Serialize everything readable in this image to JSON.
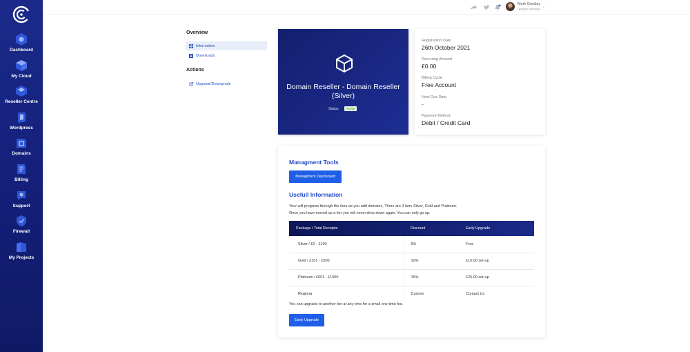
{
  "sidebar": {
    "items": [
      {
        "label": "Dashboard",
        "icon": "dashboard-icon"
      },
      {
        "label": "My Cloud",
        "icon": "cloud-icon"
      },
      {
        "label": "Reseller Centre",
        "icon": "reseller-icon"
      },
      {
        "label": "Wordpress",
        "icon": "wordpress-icon"
      },
      {
        "label": "Domains",
        "icon": "domains-icon"
      },
      {
        "label": "Billing",
        "icon": "billing-icon"
      },
      {
        "label": "Support",
        "icon": "support-icon"
      },
      {
        "label": "Firewall",
        "icon": "firewall-icon"
      },
      {
        "label": "My Projects",
        "icon": "projects-icon"
      }
    ]
  },
  "topbar": {
    "user_name": "Mark Grieday",
    "user_org": "UKBSD GROUP"
  },
  "menu": {
    "overview_title": "Overview",
    "information": "Information",
    "downloads": "Downloads",
    "actions_title": "Actions",
    "upgrade": "Upgrade/Downgrade"
  },
  "product": {
    "title": "Domain Reseller - Domain Reseller (Silver)",
    "status_label": "Status:",
    "status_value": "Active"
  },
  "info": {
    "registration_label": "Registration Date",
    "registration_value": "26th October 2021",
    "recurring_label": "Recurring Amount",
    "recurring_value": "£0.00",
    "cycle_label": "Billing Cycle",
    "cycle_value": "Free Account",
    "due_label": "Next Due Date",
    "due_value": "-",
    "payment_label": "Payment Method",
    "payment_value": "Debit / Credit Card"
  },
  "tools": {
    "title": "Managment Tools",
    "dashboard_button": "Managment Dashboard"
  },
  "useful": {
    "title": "Usefull Information",
    "line1": "Your will progress through the tiers as you add domains, There are 3 tiers Silver, Gold and Platinum.",
    "line2": "Once you have moved up a tier you will never drop down again. You can only go up.",
    "headers": [
      "Package / Total Receipts",
      "Discount",
      "Early Upgrade"
    ],
    "rows": [
      [
        "Silver / £0 - £100",
        "5%",
        "Free"
      ],
      [
        "Gold / £101 - £500",
        "10%",
        "£15.00 set-up"
      ],
      [
        "Platinum / £501 - £1500",
        "15%",
        "£25.00 set-up"
      ],
      [
        "Registra",
        "Custom",
        "Contact Us"
      ]
    ],
    "footer": "You can upgrade to another tier at any time for a small one time fee.",
    "early_button": "Early Upgrade"
  }
}
